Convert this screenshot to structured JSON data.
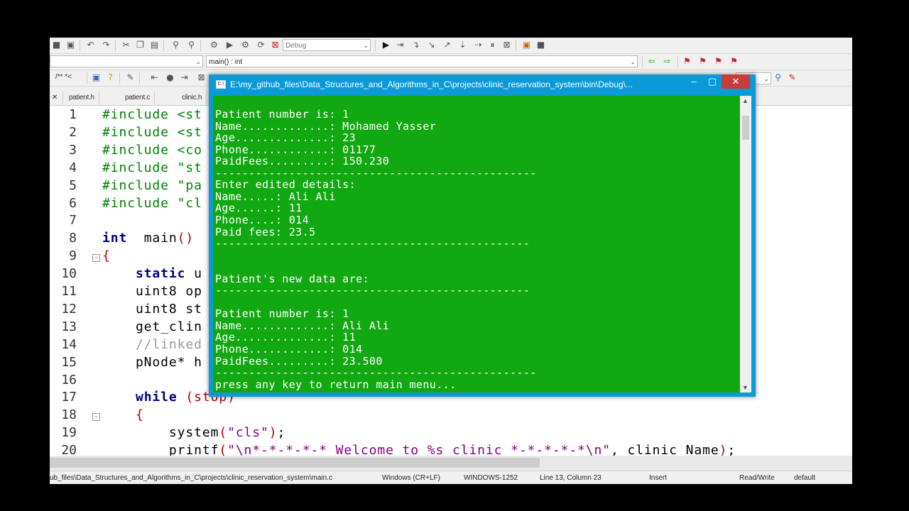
{
  "toolbar": {
    "config_combo": "Debug",
    "function_combo": "main() : int",
    "comment_btn": "/** *<"
  },
  "tabs": [
    "patient.h",
    "patient.c",
    "clinic.h"
  ],
  "editor": {
    "line_numbers": [
      "1",
      "2",
      "3",
      "4",
      "5",
      "6",
      "7",
      "8",
      "9",
      "10",
      "11",
      "12",
      "13",
      "14",
      "15",
      "16",
      "17",
      "18",
      "19",
      "20"
    ],
    "lines": [
      [
        [
          "pp",
          "#include <st"
        ]
      ],
      [
        [
          "pp",
          "#include <st"
        ]
      ],
      [
        [
          "pp",
          "#include <co"
        ]
      ],
      [
        [
          "pp",
          "#include \"st"
        ]
      ],
      [
        [
          "pp",
          "#include \"pa"
        ]
      ],
      [
        [
          "pp",
          "#include \"cl"
        ]
      ],
      [],
      [
        [
          "kw",
          "int"
        ],
        [
          "",
          "  main"
        ],
        [
          "pu",
          "()"
        ]
      ],
      [
        [
          "pu",
          "{"
        ]
      ],
      [
        [
          "",
          "    "
        ],
        [
          "kw",
          "static"
        ],
        [
          "",
          " u"
        ]
      ],
      [
        [
          "",
          "    uint8 op"
        ]
      ],
      [
        [
          "",
          "    uint8 st"
        ]
      ],
      [
        [
          "",
          "    get_clin"
        ]
      ],
      [
        [
          "",
          "    "
        ],
        [
          "cm",
          "//linked"
        ]
      ],
      [
        [
          "",
          "    pNode* h"
        ]
      ],
      [],
      [
        [
          "",
          "    "
        ],
        [
          "kw",
          "while"
        ],
        [
          "",
          " "
        ],
        [
          "pu",
          "(stop)"
        ]
      ],
      [
        [
          "",
          "    "
        ],
        [
          "pu",
          "{"
        ]
      ],
      [
        [
          "",
          "        system"
        ],
        [
          "pu",
          "("
        ],
        [
          "str",
          "\"cls\""
        ],
        [
          "pu",
          ")"
        ],
        [
          "",
          ";"
        ]
      ],
      [
        [
          "",
          "        printf"
        ],
        [
          "pu",
          "("
        ],
        [
          "str",
          "\"\\n*-*-*-*-* Welcome to %s clinic *-*-*-*-*\\n\""
        ],
        [
          "",
          ", clinic_Name"
        ],
        [
          "pu",
          ")"
        ],
        [
          "",
          ";"
        ]
      ]
    ]
  },
  "console": {
    "title": "E:\\my_github_files\\Data_Structures_and_Algorithms_in_C\\projects\\clinic_reservation_system\\bin\\Debug\\...",
    "lines": [
      "Patient number is: 1",
      "Name.............: Mohamed Yasser",
      "Age..............: 23",
      "Phone............: 01177",
      "PaidFees.........: 150.230",
      "------------------------------------------------",
      "Enter edited details:",
      "Name.....: Ali Ali",
      "Age......: 11",
      "Phone....: 014",
      "Paid fees: 23.5",
      "-----------------------------------------------",
      "",
      "",
      "Patient's new data are:",
      "-----------------------------------------------",
      "",
      "Patient number is: 1",
      "Name.............: Ali Ali",
      "Age..............: 11",
      "Phone............: 014",
      "PaidFees.........: 23.500",
      "------------------------------------------------",
      "press any key to return main menu..."
    ]
  },
  "status": {
    "path": "ub_files\\Data_Structures_and_Algorithms_in_C\\projects\\clinic_reservation_system\\main.c",
    "eol": "Windows (CR+LF)",
    "encoding": "WINDOWS-1252",
    "position": "Line 13, Column 23",
    "mode": "Insert",
    "access": "Read/Write",
    "lang": "default"
  }
}
